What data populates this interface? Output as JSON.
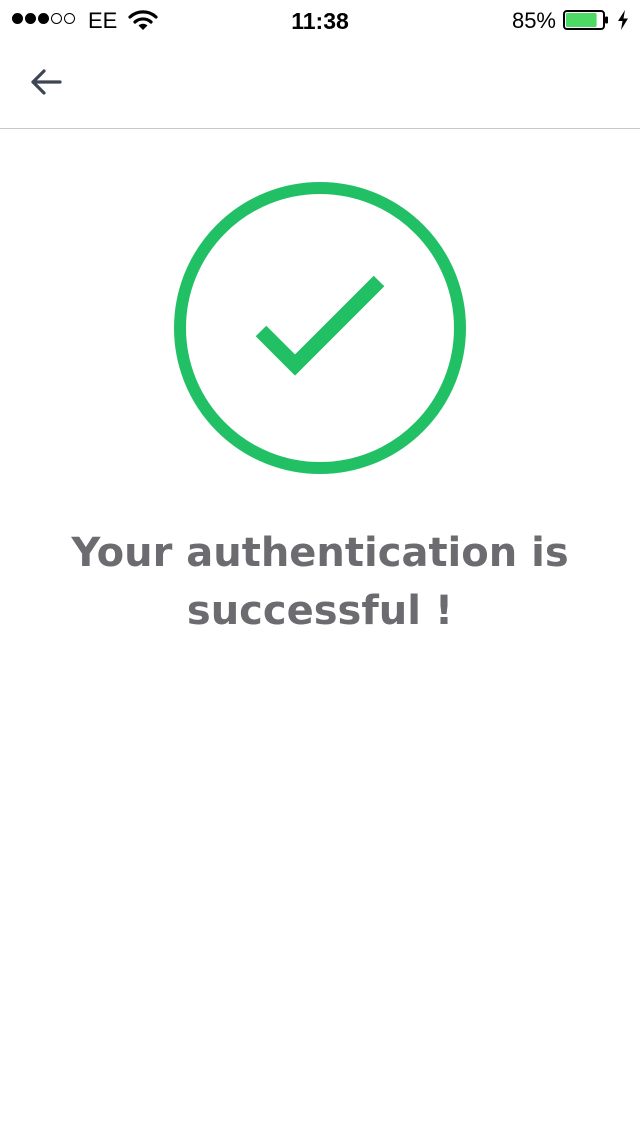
{
  "status_bar": {
    "carrier": "EE",
    "time": "11:38",
    "battery_percent": "85%",
    "battery_level": 0.85,
    "signal_bars_filled": 3,
    "signal_bars_total": 5,
    "icons": [
      "wifi-icon",
      "battery-icon",
      "charging-bolt-icon"
    ]
  },
  "nav": {
    "back_icon": "arrow-left-icon"
  },
  "main": {
    "success_icon": "check-circle-icon",
    "message": "Your authentication is successful !"
  },
  "colors": {
    "success_green": "#22c065",
    "text_gray": "#6b6b70",
    "divider": "#c8c8c8",
    "battery_green": "#4cd964",
    "icon_dark": "#3d4651"
  }
}
